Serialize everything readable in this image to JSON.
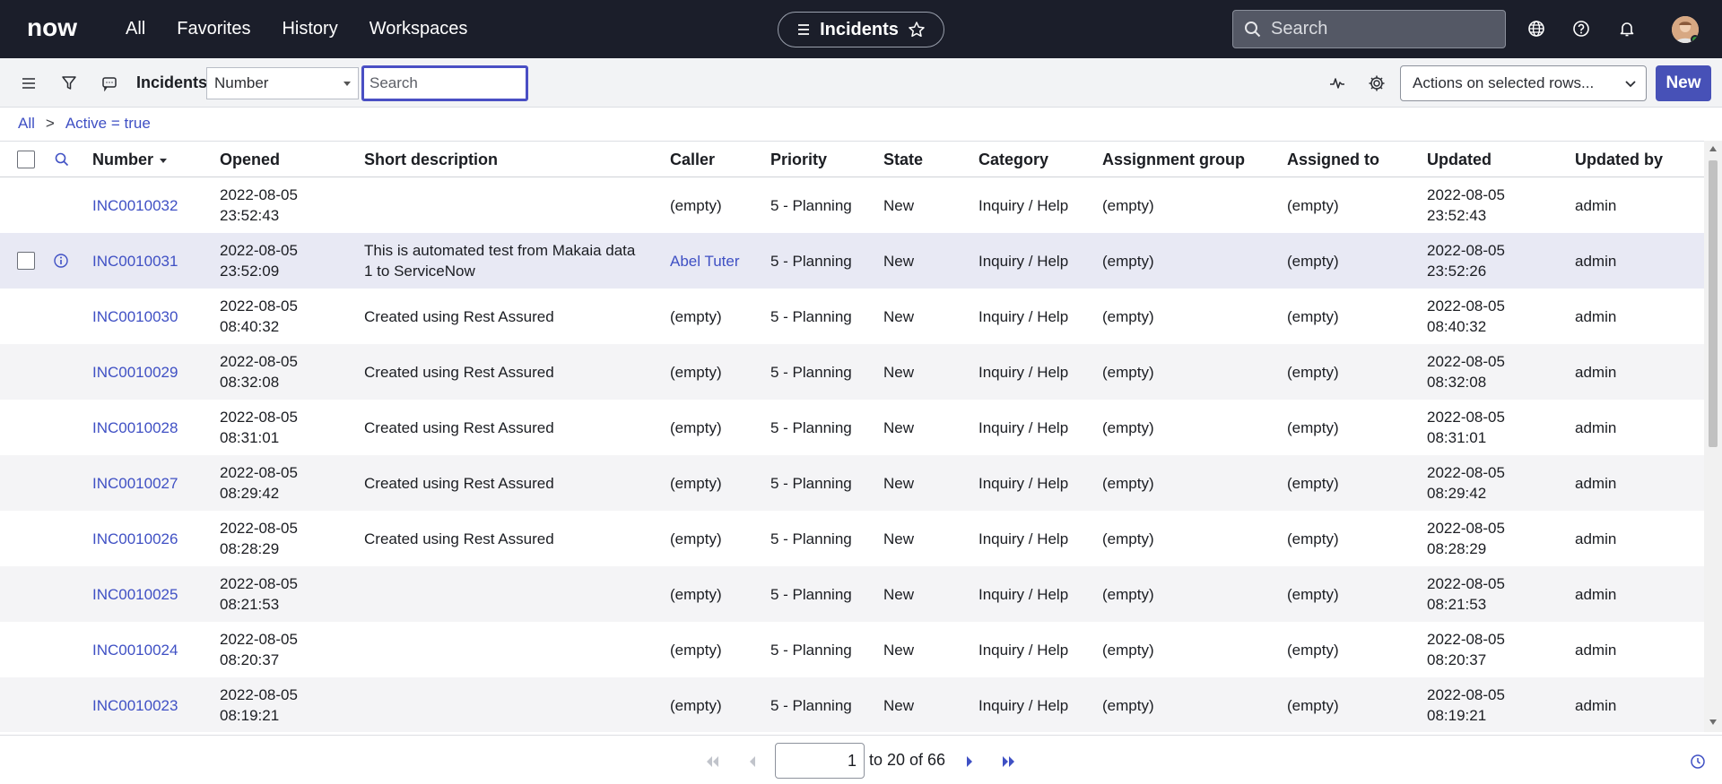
{
  "topnav": {
    "logo_text": "now",
    "links": [
      "All",
      "Favorites",
      "History",
      "Workspaces"
    ],
    "context_title": "Incidents",
    "search_placeholder": "Search"
  },
  "toolbar": {
    "title": "Incidents",
    "field_select": "Number",
    "search_placeholder": "Search",
    "actions_select": "Actions on selected rows...",
    "new_label": "New"
  },
  "breadcrumb": {
    "root": "All",
    "separator": ">",
    "filter": "Active = true"
  },
  "table": {
    "columns": [
      "Number",
      "Opened",
      "Short description",
      "Caller",
      "Priority",
      "State",
      "Category",
      "Assignment group",
      "Assigned to",
      "Updated",
      "Updated by"
    ],
    "rows": [
      {
        "number": "INC0010032",
        "opened_date": "2022-08-05",
        "opened_time": "23:52:43",
        "desc1": "",
        "desc2": "",
        "caller": "(empty)",
        "priority": "5 - Planning",
        "state": "New",
        "category": "Inquiry / Help",
        "group": "(empty)",
        "assigned": "(empty)",
        "updated_date": "2022-08-05",
        "updated_time": "23:52:43",
        "updated_by": "admin"
      },
      {
        "number": "INC0010031",
        "opened_date": "2022-08-05",
        "opened_time": "23:52:09",
        "desc1": "This is automated test from Makaia data",
        "desc2": "1 to ServiceNow",
        "caller": "Abel Tuter",
        "priority": "5 - Planning",
        "state": "New",
        "category": "Inquiry / Help",
        "group": "(empty)",
        "assigned": "(empty)",
        "updated_date": "2022-08-05",
        "updated_time": "23:52:26",
        "updated_by": "admin"
      },
      {
        "number": "INC0010030",
        "opened_date": "2022-08-05",
        "opened_time": "08:40:32",
        "desc1": "Created using Rest Assured",
        "desc2": "",
        "caller": "(empty)",
        "priority": "5 - Planning",
        "state": "New",
        "category": "Inquiry / Help",
        "group": "(empty)",
        "assigned": "(empty)",
        "updated_date": "2022-08-05",
        "updated_time": "08:40:32",
        "updated_by": "admin"
      },
      {
        "number": "INC0010029",
        "opened_date": "2022-08-05",
        "opened_time": "08:32:08",
        "desc1": "Created using Rest Assured",
        "desc2": "",
        "caller": "(empty)",
        "priority": "5 - Planning",
        "state": "New",
        "category": "Inquiry / Help",
        "group": "(empty)",
        "assigned": "(empty)",
        "updated_date": "2022-08-05",
        "updated_time": "08:32:08",
        "updated_by": "admin"
      },
      {
        "number": "INC0010028",
        "opened_date": "2022-08-05",
        "opened_time": "08:31:01",
        "desc1": "Created using Rest Assured",
        "desc2": "",
        "caller": "(empty)",
        "priority": "5 - Planning",
        "state": "New",
        "category": "Inquiry / Help",
        "group": "(empty)",
        "assigned": "(empty)",
        "updated_date": "2022-08-05",
        "updated_time": "08:31:01",
        "updated_by": "admin"
      },
      {
        "number": "INC0010027",
        "opened_date": "2022-08-05",
        "opened_time": "08:29:42",
        "desc1": "Created using Rest Assured",
        "desc2": "",
        "caller": "(empty)",
        "priority": "5 - Planning",
        "state": "New",
        "category": "Inquiry / Help",
        "group": "(empty)",
        "assigned": "(empty)",
        "updated_date": "2022-08-05",
        "updated_time": "08:29:42",
        "updated_by": "admin"
      },
      {
        "number": "INC0010026",
        "opened_date": "2022-08-05",
        "opened_time": "08:28:29",
        "desc1": "Created using Rest Assured",
        "desc2": "",
        "caller": "(empty)",
        "priority": "5 - Planning",
        "state": "New",
        "category": "Inquiry / Help",
        "group": "(empty)",
        "assigned": "(empty)",
        "updated_date": "2022-08-05",
        "updated_time": "08:28:29",
        "updated_by": "admin"
      },
      {
        "number": "INC0010025",
        "opened_date": "2022-08-05",
        "opened_time": "08:21:53",
        "desc1": "",
        "desc2": "",
        "caller": "(empty)",
        "priority": "5 - Planning",
        "state": "New",
        "category": "Inquiry / Help",
        "group": "(empty)",
        "assigned": "(empty)",
        "updated_date": "2022-08-05",
        "updated_time": "08:21:53",
        "updated_by": "admin"
      },
      {
        "number": "INC0010024",
        "opened_date": "2022-08-05",
        "opened_time": "08:20:37",
        "desc1": "",
        "desc2": "",
        "caller": "(empty)",
        "priority": "5 - Planning",
        "state": "New",
        "category": "Inquiry / Help",
        "group": "(empty)",
        "assigned": "(empty)",
        "updated_date": "2022-08-05",
        "updated_time": "08:20:37",
        "updated_by": "admin"
      },
      {
        "number": "INC0010023",
        "opened_date": "2022-08-05",
        "opened_time": "08:19:21",
        "desc1": "",
        "desc2": "",
        "caller": "(empty)",
        "priority": "5 - Planning",
        "state": "New",
        "category": "Inquiry / Help",
        "group": "(empty)",
        "assigned": "(empty)",
        "updated_date": "2022-08-05",
        "updated_time": "08:19:21",
        "updated_by": "admin"
      }
    ]
  },
  "pagination": {
    "current": "1",
    "range_text": "to 20 of 66"
  },
  "colors": {
    "nav_bg": "#1b1e2a",
    "accent": "#4751b7",
    "link": "#3f50c4",
    "highlight_row": "#e8e9f4"
  },
  "icons": [
    "hamburger-icon",
    "filter-icon",
    "chat-icon",
    "search-icon",
    "star-icon",
    "globe-icon",
    "help-icon",
    "bell-icon",
    "pulse-icon",
    "gear-icon",
    "info-icon",
    "sort-down-icon",
    "first-page-icon",
    "prev-page-icon",
    "next-page-icon",
    "last-page-icon",
    "clock-icon"
  ]
}
